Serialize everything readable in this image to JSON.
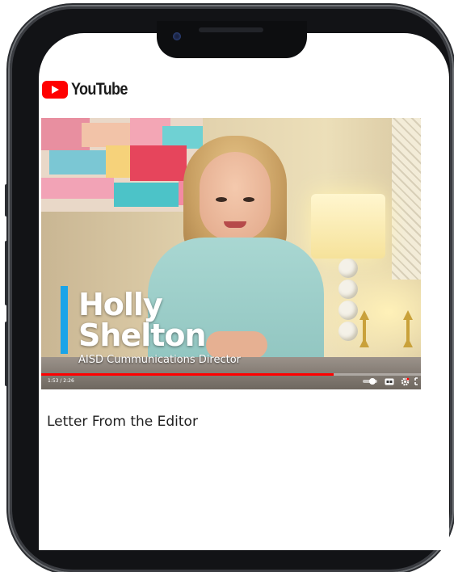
{
  "app": {
    "brand": "YouTube",
    "brand_color": "#ff0000"
  },
  "video": {
    "overlay": {
      "name_first": "Holly",
      "name_last": "Shelton",
      "role": "AISD Cummunications Director",
      "accent_color": "#1aa4e8"
    },
    "player": {
      "time": "1:53 / 2:26",
      "progress": 0.77,
      "controls": [
        "autoplay-toggle-icon",
        "captions-icon",
        "settings-icon",
        "fullscreen-icon"
      ]
    },
    "title": "Letter From the Editor"
  }
}
